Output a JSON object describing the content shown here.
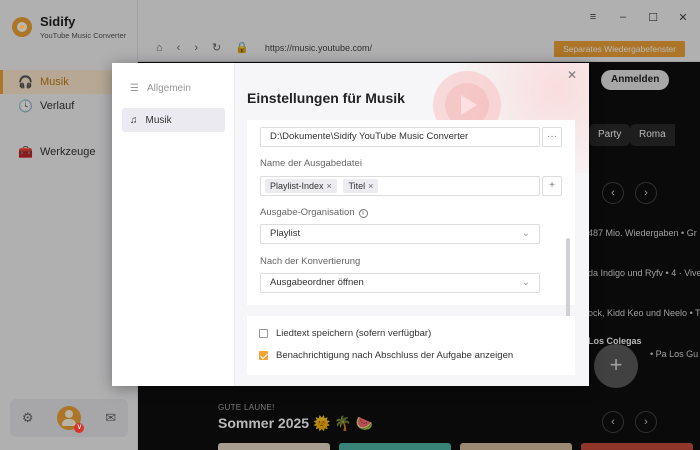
{
  "app": {
    "name": "Sidify",
    "subtitle": "YouTube Music Converter"
  },
  "sidebar": {
    "items": [
      {
        "label": "Musik",
        "icon": "headphones-icon",
        "active": true
      },
      {
        "label": "Verlauf",
        "icon": "clock-icon",
        "active": false
      },
      {
        "label": "Werkzeuge",
        "icon": "toolbox-icon",
        "active": false
      }
    ],
    "bottom": {
      "settings_icon": "gear-icon",
      "avatar_icon": "user-avatar-icon",
      "mail_icon": "mail-icon"
    }
  },
  "window": {
    "controls": [
      "menu-icon",
      "minimize-icon",
      "maximize-icon",
      "close-icon"
    ]
  },
  "browser": {
    "url": "https://music.youtube.com/",
    "separate_playlist_button": "Separates Wiedergabefenster"
  },
  "youtube": {
    "login_button": "Anmelden",
    "chips": [
      "Party",
      "Roma"
    ],
    "lines": [
      "487 Mio. Wiedergaben • Gr",
      "da Indigo und Ryfv • 4 · Vive",
      "ock, Kidd Keo und Neelo • Te"
    ],
    "los_title": "Los Colegas",
    "los_sub": "• Pa Los Gu",
    "section_kicker": "GUTE LAUNE!",
    "section_title": "Sommer 2025 🌞 🌴 🍉"
  },
  "dialog": {
    "title": "Einstellungen für Musik",
    "nav": [
      {
        "label": "Allgemein",
        "icon": "sliders-icon",
        "active": false
      },
      {
        "label": "Musik",
        "icon": "music-note-icon",
        "active": true
      }
    ],
    "output_path": "D:\\Dokumente\\Sidify YouTube Music Converter",
    "browse_button": "···",
    "filename_label": "Name der Ausgabedatei",
    "filename_tags": [
      "Playlist-Index",
      "Titel"
    ],
    "add_button": "+",
    "organization_label": "Ausgabe-Organisation",
    "organization_value": "Playlist",
    "after_label": "Nach der Konvertierung",
    "after_value": "Ausgabeordner öffnen",
    "lyrics_label": "Liedtext speichern (sofern verfügbar)",
    "lyrics_checked": false,
    "notify_label": "Benachrichtigung nach Abschluss der Aufgabe anzeigen",
    "notify_checked": true
  }
}
